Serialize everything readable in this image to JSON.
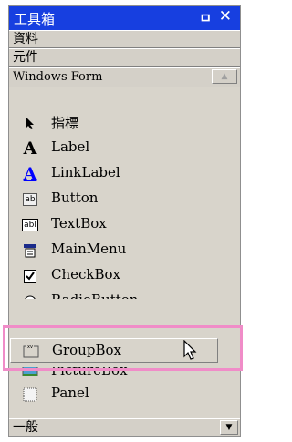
{
  "window": {
    "title": "工具箱",
    "pin_icon": "pin-icon",
    "close_label": "✕"
  },
  "categories": {
    "data": "資料",
    "components": "元件",
    "windows_form": "Windows Form",
    "general": "一般"
  },
  "items": [
    {
      "label": "指標",
      "icon": "pointer-icon"
    },
    {
      "label": "Label",
      "icon": "label-icon"
    },
    {
      "label": "LinkLabel",
      "icon": "linklabel-icon"
    },
    {
      "label": "Button",
      "icon": "button-icon"
    },
    {
      "label": "TextBox",
      "icon": "textbox-icon"
    },
    {
      "label": "MainMenu",
      "icon": "mainmenu-icon"
    },
    {
      "label": "CheckBox",
      "icon": "checkbox-icon"
    },
    {
      "label": "RadioButton",
      "icon": "radiobutton-icon"
    },
    {
      "label": "GroupBox",
      "icon": "groupbox-icon"
    },
    {
      "label": "PictureBox",
      "icon": "picturebox-icon"
    },
    {
      "label": "Panel",
      "icon": "panel-icon"
    }
  ],
  "icon_texts": {
    "label": "A",
    "linklabel": "A",
    "button": "ab",
    "textbox": "abl",
    "groupbox": "xv"
  },
  "colors": {
    "titlebar": "#173fe0",
    "highlight": "#f08cc8",
    "link": "#0000ff"
  }
}
